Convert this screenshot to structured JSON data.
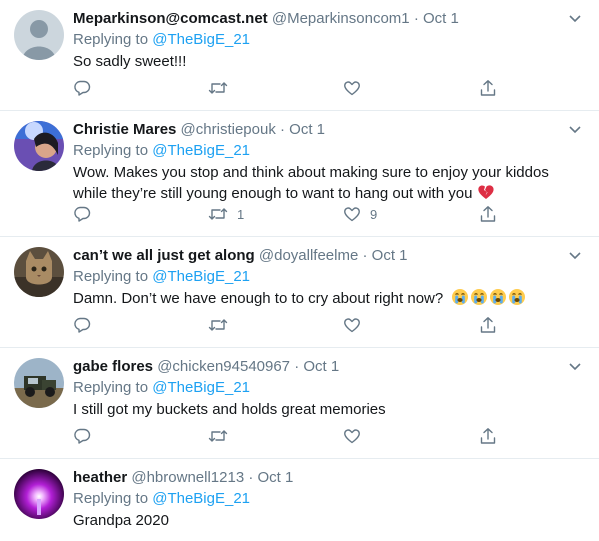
{
  "colors": {
    "link": "#1da1f2",
    "muted": "#657786",
    "text": "#14171a",
    "divider": "#e6ecf0"
  },
  "tweets": [
    {
      "name": "Meparkinson@comcast.net",
      "handle": "@Meparkinsoncom1",
      "sep": "·",
      "date": "Oct 1",
      "replying_prefix": "Replying to",
      "replying_to": "@TheBigE_21",
      "text": "So sadly sweet!!!",
      "retweets": "",
      "likes": "",
      "avatar": "default-user-avatar"
    },
    {
      "name": "Christie Mares",
      "handle": "@christiepouk",
      "sep": "·",
      "date": "Oct 1",
      "replying_prefix": "Replying to",
      "replying_to": "@TheBigE_21",
      "text": "Wow. Makes you stop and think about making sure to enjoy your kiddos while they’re still young enough to want to hang out with you",
      "emoji": "broken-heart-icon",
      "retweets": "1",
      "likes": "9",
      "avatar": "profile-photo"
    },
    {
      "name": "can’t we all just get along",
      "handle": "@doyallfeelme",
      "sep": "·",
      "date": "Oct 1",
      "replying_prefix": "Replying to",
      "replying_to": "@TheBigE_21",
      "text": "Damn. Don’t we have enough to to cry about right now?",
      "emoji": "crying-face-icon",
      "emoji_count": 4,
      "retweets": "",
      "likes": "",
      "avatar": "cat-photo"
    },
    {
      "name": "gabe flores",
      "handle": "@chicken94540967",
      "sep": "·",
      "date": "Oct 1",
      "replying_prefix": "Replying to",
      "replying_to": "@TheBigE_21",
      "text": "I still got my buckets and holds great memories",
      "retweets": "",
      "likes": "",
      "avatar": "truck-photo"
    },
    {
      "name": "heather",
      "handle": "@hbrownell1213",
      "sep": "·",
      "date": "Oct 1",
      "replying_prefix": "Replying to",
      "replying_to": "@TheBigE_21",
      "text": "Grandpa 2020",
      "retweets": "",
      "likes": "",
      "avatar": "purple-light-photo"
    }
  ]
}
